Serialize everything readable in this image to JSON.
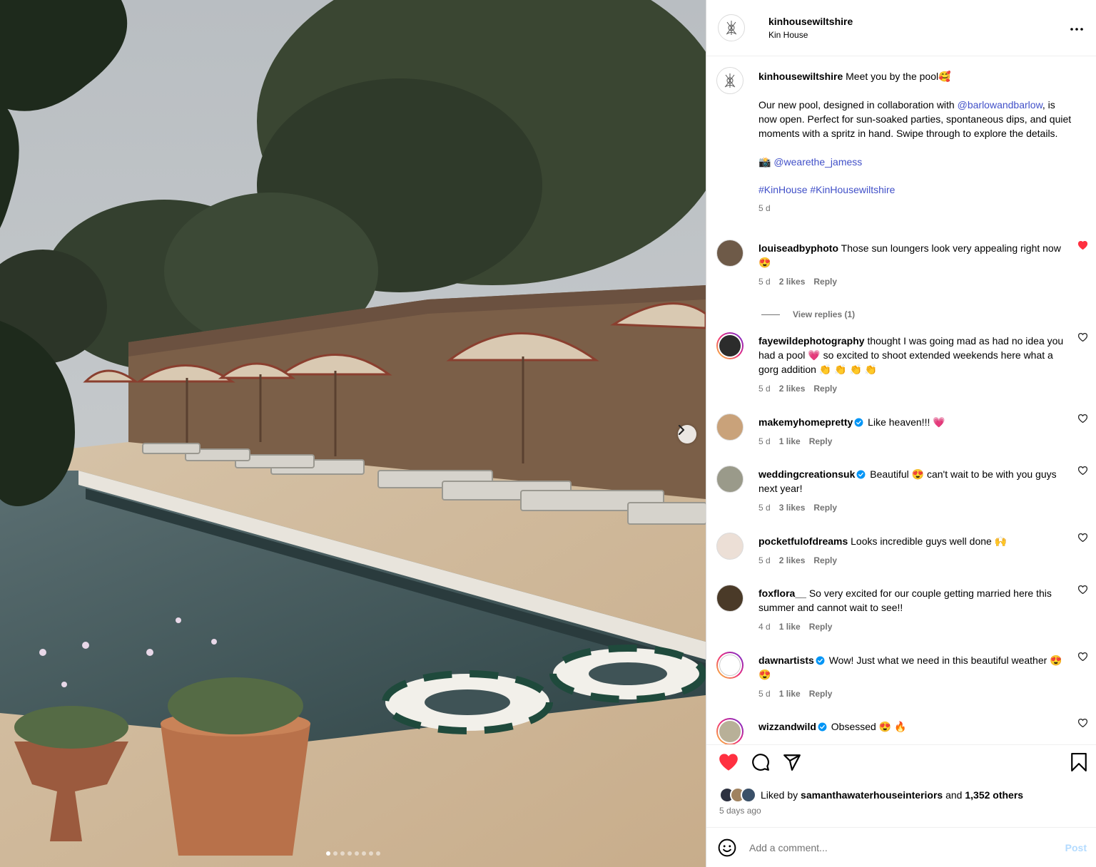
{
  "post": {
    "author": "kinhousewiltshire",
    "location": "Kin House",
    "carousel": {
      "slide_count": 8,
      "active_slide": 1
    }
  },
  "caption": {
    "username": "kinhousewiltshire",
    "line1": "Meet you by the pool🥰",
    "body_before": "Our new pool, designed in collaboration with",
    "mention1": "@barlowandbarlow",
    "body_after": ", is now open. Perfect for sun-soaked parties, spontaneous dips, and quiet moments with a spritz in hand. Swipe through to explore the details.",
    "camera_emoji": "📸",
    "mention2": "@wearethe_jamess",
    "hashtags": "#KinHouse #KinHousewiltshire",
    "time": "5 d"
  },
  "comments": [
    {
      "username": "louiseadbyphoto",
      "verified": false,
      "text": "Those sun loungers look very appealing right now 😍",
      "time": "5 d",
      "likes": "2 likes",
      "reply": "Reply",
      "liked": true,
      "view_replies": "View replies (1)"
    },
    {
      "username": "fayewildephotography",
      "verified": false,
      "text": "thought I was going mad as had no idea you had a pool 💗 so excited to shoot extended weekends here what a gorg addition 👏 👏 👏 👏",
      "time": "5 d",
      "likes": "2 likes",
      "reply": "Reply",
      "liked": false
    },
    {
      "username": "makemyhomepretty",
      "verified": true,
      "text": "Like heaven!!! 💗",
      "time": "5 d",
      "likes": "1 like",
      "reply": "Reply",
      "liked": false
    },
    {
      "username": "weddingcreationsuk",
      "verified": true,
      "text": "Beautiful 😍 can't wait to be with you guys next year!",
      "time": "5 d",
      "likes": "3 likes",
      "reply": "Reply",
      "liked": false
    },
    {
      "username": "pocketfulofdreams",
      "verified": false,
      "text": "Looks incredible guys well done 🙌",
      "time": "5 d",
      "likes": "2 likes",
      "reply": "Reply",
      "liked": false
    },
    {
      "username": "foxflora__",
      "verified": false,
      "text": "So very excited for our couple getting married here this summer and cannot wait to see!!",
      "time": "4 d",
      "likes": "1 like",
      "reply": "Reply",
      "liked": false
    },
    {
      "username": "dawnartists",
      "verified": true,
      "text": "Wow! Just what we need in this beautiful weather 😍 😍",
      "time": "5 d",
      "likes": "1 like",
      "reply": "Reply",
      "liked": false
    },
    {
      "username": "wizzandwild",
      "verified": true,
      "text": "Obsessed 😍 🔥",
      "time": "",
      "likes": "",
      "reply": "",
      "liked": false
    }
  ],
  "likes_line": {
    "prefix": "Liked by",
    "user": "samanthawaterhouseinteriors",
    "and": "and",
    "others": "1,352 others"
  },
  "posted_ago": "5 days ago",
  "comment_box": {
    "placeholder": "Add a comment...",
    "post_label": "Post"
  },
  "colors": {
    "like_red": "#ff3040",
    "link_blue": "#4150c8",
    "post_disabled": "#b3dbff"
  },
  "icons": [
    "more-icon",
    "next-arrow-icon",
    "heart-icon",
    "comment-icon",
    "share-icon",
    "bookmark-icon",
    "emoji-icon",
    "verified-badge-icon"
  ]
}
